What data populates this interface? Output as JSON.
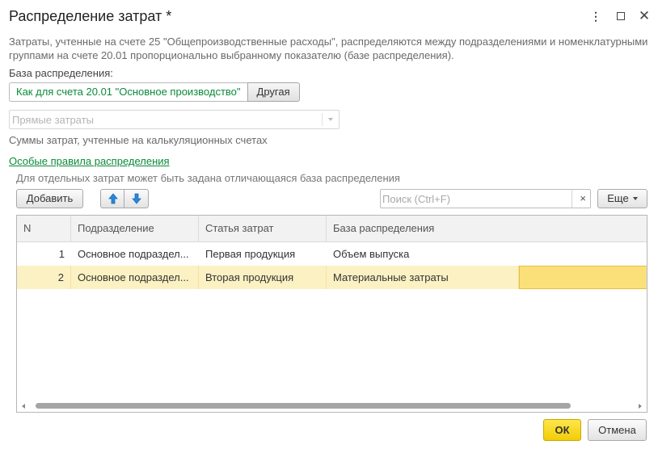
{
  "window": {
    "title": "Распределение затрат *",
    "more_icon": "vertical-dots-icon",
    "maximize_icon": "maximize-icon",
    "close_icon": "close-icon"
  },
  "description": "Затраты, учтенные на счете 25 \"Общепроизводственные расходы\", распределяются между подразделениями и номенклатурными группами на счете 20.01 пропорционально выбранному показателю (базе распределения).",
  "base": {
    "label": "База распределения:",
    "option_selected": "Как для счета 20.01 \"Основное производство\"",
    "option_other": "Другая"
  },
  "base_combo": {
    "value": "Прямые затраты",
    "hint": "Суммы затрат, учтенные на калькуляционных счетах"
  },
  "special_rules": {
    "link": "Особые правила распределения",
    "hint": "Для отдельных затрат может быть задана отличающаяся база распределения"
  },
  "toolbar": {
    "add_label": "Добавить",
    "search_placeholder": "Поиск (Ctrl+F)",
    "clear_symbol": "×",
    "more_label": "Еще"
  },
  "table": {
    "columns": [
      "N",
      "Подразделение",
      "Статья затрат",
      "База распределения"
    ],
    "rows": [
      {
        "n": "1",
        "department": "Основное подраздел...",
        "cost_item": "Первая продукция",
        "base": "Объем выпуска"
      },
      {
        "n": "2",
        "department": "Основное подраздел...",
        "cost_item": "Вторая продукция",
        "base": "Материальные затраты"
      }
    ],
    "selected_row": 2
  },
  "footer": {
    "ok_label": "ОК",
    "cancel_label": "Отмена"
  },
  "colors": {
    "accent_green": "#0b8a3a",
    "selected_row": "#fbf1c3",
    "focused_cell": "#fbe07a",
    "ok_button": "#f5d30e",
    "arrow_blue": "#2a86d8"
  }
}
